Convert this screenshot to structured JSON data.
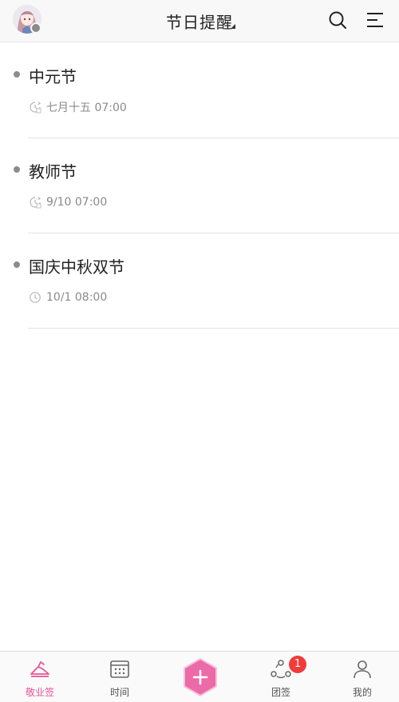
{
  "header": {
    "title": "节日提醒",
    "icons": [
      "avatar",
      "search-icon",
      "menu-icon"
    ]
  },
  "reminders": [
    {
      "title": "中元节",
      "time": "七月十五 07:00",
      "icon": "lunar-repeat-icon"
    },
    {
      "title": "教师节",
      "time": "9/10 07:00",
      "icon": "lunar-repeat-icon"
    },
    {
      "title": "国庆中秋双节",
      "time": "10/1 08:00",
      "icon": "clock-icon"
    }
  ],
  "tabbar": {
    "tabs": [
      {
        "label": "敬业签",
        "icon": "note-icon",
        "active": true
      },
      {
        "label": "时间",
        "icon": "calendar-icon"
      },
      {
        "label": "",
        "icon": "add-icon"
      },
      {
        "label": "团签",
        "icon": "team-icon",
        "badge": "1"
      },
      {
        "label": "我的",
        "icon": "user-icon"
      }
    ]
  },
  "colors": {
    "accent": "#e8539b",
    "fab": "#ec6aa8",
    "badge": "#f23b3b",
    "muted_text": "#8a8a8a"
  }
}
